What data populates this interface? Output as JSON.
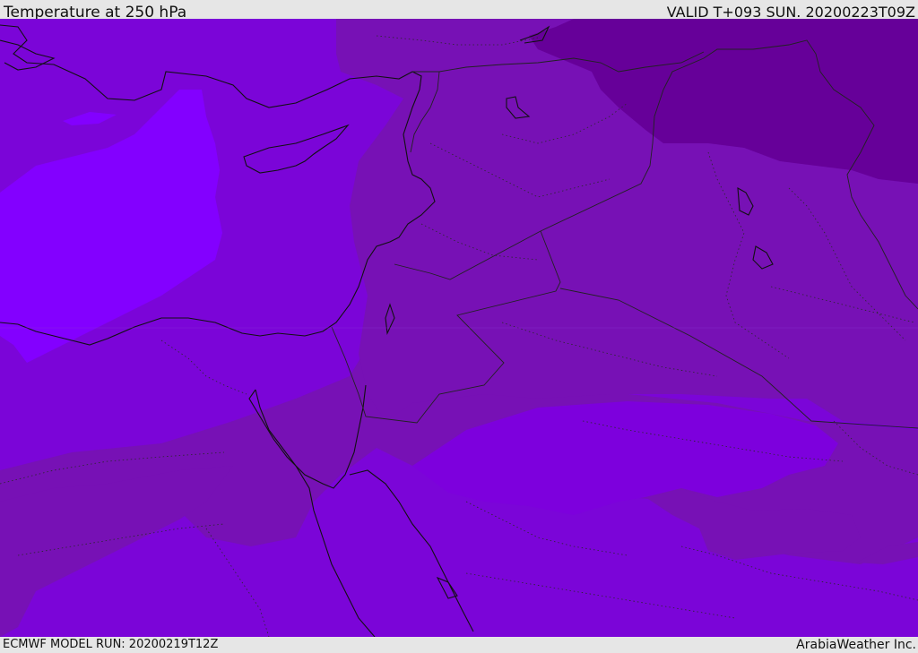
{
  "header": {
    "title": "Temperature at 250 hPa",
    "valid": "VALID T+093 SUN. 20200223T09Z"
  },
  "footer": {
    "model_run": "ECMWF MODEL RUN: 20200219T12Z",
    "credit": "ArabiaWeather Inc."
  },
  "colors": {
    "coldest": "#660099",
    "cold": "#7711b5",
    "mid": "#7d00dd",
    "warm": "#8300ff",
    "coast": "#111111",
    "borders": "#222222"
  }
}
